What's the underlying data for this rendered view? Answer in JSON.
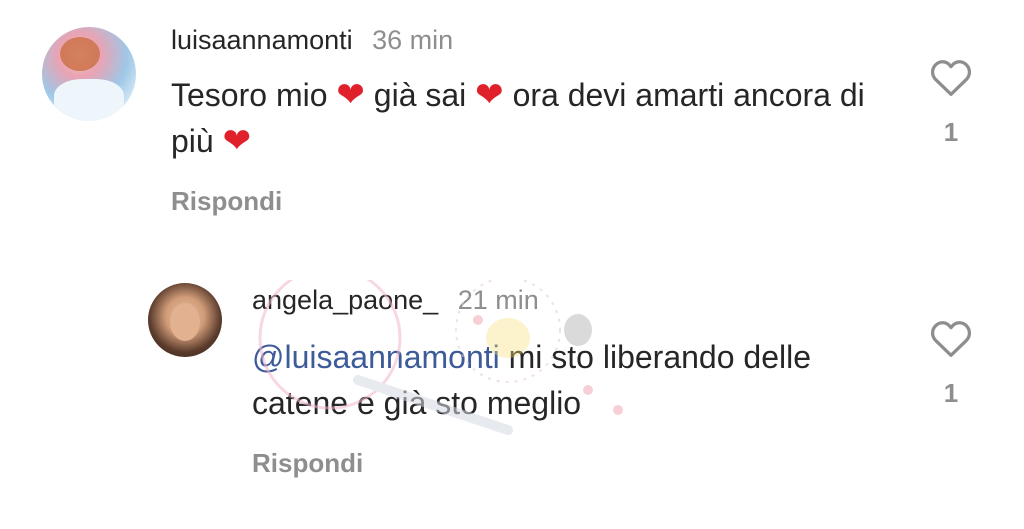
{
  "comments": [
    {
      "username": "luisaannamonti",
      "time": "36 min",
      "text_parts": [
        "Tesoro mio ",
        "❤",
        " già sai ",
        "❤",
        " ora devi amarti ancora di più ",
        "❤"
      ],
      "reply_label": "Rispondi",
      "like_count": "1",
      "like_icon": "heart-outline-icon"
    },
    {
      "username": "angela_paone_",
      "time": "21 min",
      "mention": "@luisaannamonti",
      "text": " mi sto liberando delle catene e già sto meglio",
      "reply_label": "Rispondi",
      "like_count": "1",
      "like_icon": "heart-outline-icon"
    }
  ],
  "colors": {
    "text": "#262626",
    "muted": "#8e8e8e",
    "mention": "#3d5a99",
    "heart_emoji": "#e0202b"
  }
}
